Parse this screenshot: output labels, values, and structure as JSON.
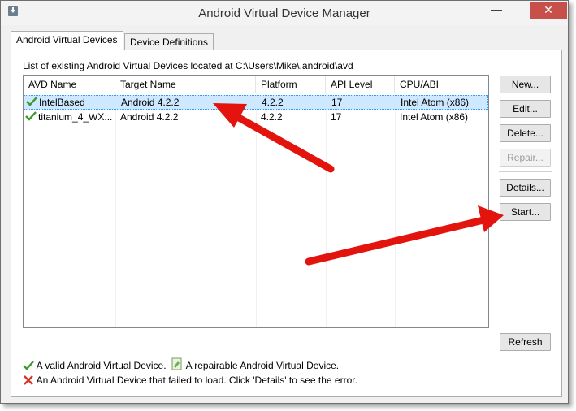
{
  "window": {
    "title": "Android Virtual Device Manager",
    "minimize": "—",
    "close": "✕"
  },
  "tabs": [
    {
      "label": "Android Virtual Devices",
      "active": true
    },
    {
      "label": "Device Definitions",
      "active": false
    }
  ],
  "list": {
    "caption": "List of existing Android Virtual Devices located at C:\\Users\\Mike\\.android\\avd",
    "columns": [
      "AVD Name",
      "Target Name",
      "Platform",
      "API Level",
      "CPU/ABI"
    ],
    "rows": [
      {
        "name": "IntelBased",
        "target": "Android 4.2.2",
        "platform": "4.2.2",
        "api": "17",
        "cpu": "Intel Atom (x86)",
        "selected": true,
        "status_icon": "check-icon"
      },
      {
        "name": "titanium_4_WX...",
        "target": "Android 4.2.2",
        "platform": "4.2.2",
        "api": "17",
        "cpu": "Intel Atom (x86)",
        "selected": false,
        "status_icon": "check-icon"
      }
    ]
  },
  "buttons": {
    "new": "New...",
    "edit": "Edit...",
    "delete": "Delete...",
    "repair": "Repair...",
    "details": "Details...",
    "start": "Start...",
    "refresh": "Refresh"
  },
  "legend": {
    "valid": "A valid Android Virtual Device.",
    "repairable": "A repairable Android Virtual Device.",
    "failed": "An Android Virtual Device that failed to load. Click 'Details' to see the error."
  },
  "colors": {
    "valid_check": "#3a9a2a",
    "error_x": "#d9342b",
    "annotation_arrow": "#e3140e",
    "close_button": "#c7504a",
    "selection": "#cde8ff"
  }
}
